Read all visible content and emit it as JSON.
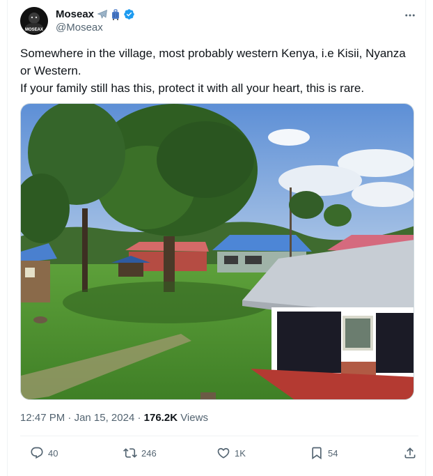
{
  "author": {
    "display_name": "Moseax",
    "badges": [
      "airplane-emoji",
      "luggage-emoji",
      "verified-badge"
    ],
    "handle": "@Moseax",
    "avatar_text": "MOSEAX"
  },
  "tweet": {
    "line1": "Somewhere in the village, most probably western Kenya, i.e Kisii, Nyanza or Western.",
    "line2": "If your family still has this, protect it with all your heart, this is rare."
  },
  "media": {
    "description_icon": "photo"
  },
  "meta": {
    "time": "12:47 PM",
    "separator": " · ",
    "date": "Jan 15, 2024",
    "views_count": "176.2K",
    "views_label": "Views"
  },
  "actions": {
    "replies": "40",
    "retweets": "246",
    "likes": "1K",
    "bookmarks": "54"
  },
  "colors": {
    "text_primary": "#0f1419",
    "text_secondary": "#536471",
    "verified": "#1d9bf0",
    "border": "#eff3f4"
  }
}
